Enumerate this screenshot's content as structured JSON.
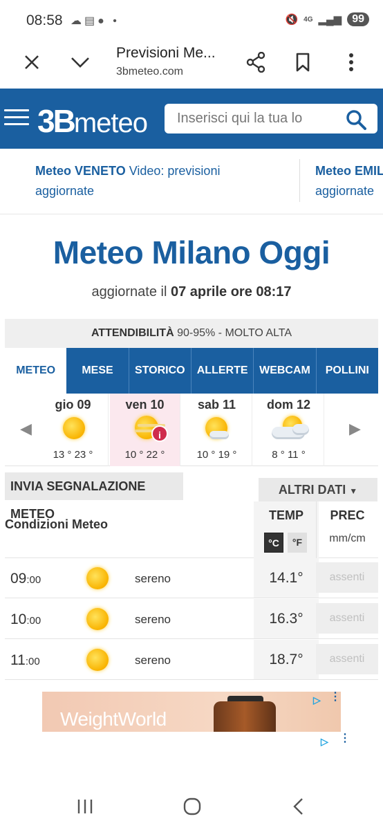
{
  "status_bar": {
    "time": "08:58",
    "battery": "99",
    "network": "4G"
  },
  "browser": {
    "title": "Previsioni Me...",
    "url": "3bmeteo.com"
  },
  "site": {
    "logo_bold": "3B",
    "logo_rest": "meteo",
    "search_placeholder": "Inserisci qui la tua lo",
    "brand_color": "#1a5fa0"
  },
  "news": [
    {
      "region": "Meteo VENETO",
      "text": " Video: previsioni",
      "line2": "aggiornate"
    },
    {
      "region": "Meteo EMIL",
      "text": "",
      "line2": "aggiornate"
    }
  ],
  "page": {
    "title": "Meteo Milano Oggi",
    "updated_prefix": "aggiornate il ",
    "updated_date": "07 aprile ore 08:17"
  },
  "reliability": {
    "label": "ATTENDIBILITÀ",
    "value": " 90-95% - MOLTO ALTA"
  },
  "tabs": [
    "METEO",
    "MESE",
    "STORICO",
    "ALLERTE",
    "WEBCAM",
    "POLLINI"
  ],
  "days": [
    {
      "name": "gio 09",
      "temps": "13 ° 23 °",
      "icon": "sun-icon"
    },
    {
      "name": "ven 10",
      "temps": "10 ° 22 °",
      "icon": "sun-haze-icon",
      "alert": "i"
    },
    {
      "name": "sab 11",
      "temps": "10 ° 19 °",
      "icon": "sun-cloud-icon"
    },
    {
      "name": "dom 12",
      "temps": "8 ° 11 °",
      "icon": "sun-clouds-icon"
    }
  ],
  "report_button": "INVIA SEGNALAZIONE METEO",
  "more_data_button": "ALTRI DATI",
  "table": {
    "condition_header": "Condizioni Meteo",
    "temp_header": "TEMP",
    "prec_header": "PREC",
    "unit_c": "°C",
    "unit_f": "°F",
    "prec_unit": "mm/cm",
    "rows": [
      {
        "hour": "09",
        "min": ":00",
        "desc": "sereno",
        "temp": "14.1°",
        "prec": "assenti"
      },
      {
        "hour": "10",
        "min": ":00",
        "desc": "sereno",
        "temp": "16.3°",
        "prec": "assenti"
      },
      {
        "hour": "11",
        "min": ":00",
        "desc": "sereno",
        "temp": "18.7°",
        "prec": "assenti"
      }
    ]
  },
  "ad": {
    "brand": "WeightWorld"
  }
}
